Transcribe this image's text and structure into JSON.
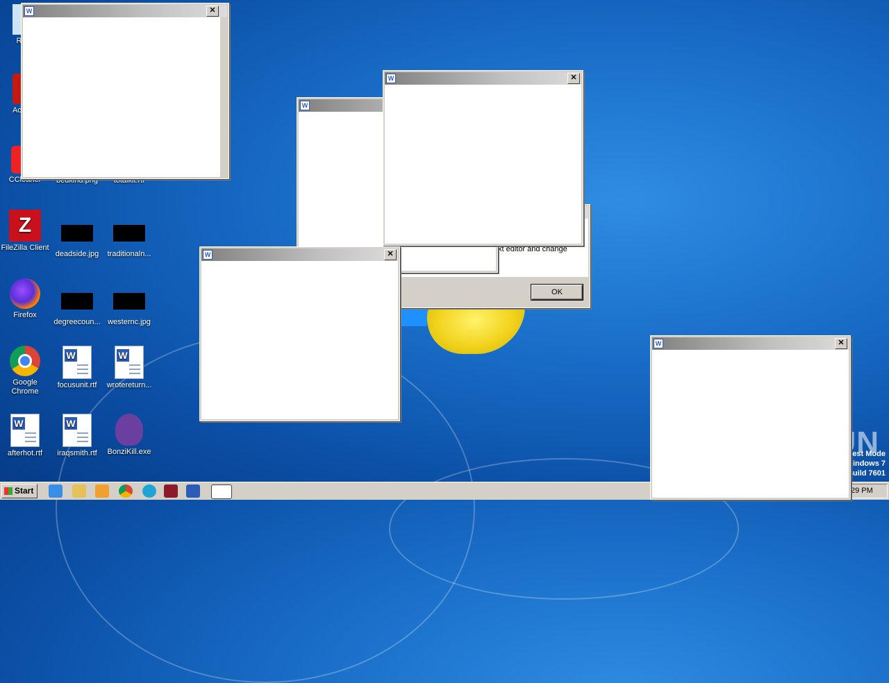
{
  "desktop": {
    "icons": [
      {
        "label": "Recy",
        "icon": "recycle-bin-icon"
      },
      {
        "label": "Ac Rea",
        "icon": "acrobat-reader-icon"
      },
      {
        "label": "CCleaner",
        "icon": "ccleaner-icon"
      },
      {
        "label": "bedkind.png",
        "icon": "image-file-icon"
      },
      {
        "label": "totalkit.rtf",
        "icon": "rtf-document-icon"
      },
      {
        "label": "FileZilla Client",
        "icon": "filezilla-icon"
      },
      {
        "label": "deadside.jpg",
        "icon": "image-file-icon"
      },
      {
        "label": "traditionaln...",
        "icon": "image-file-icon"
      },
      {
        "label": "Firefox",
        "icon": "firefox-icon"
      },
      {
        "label": "degreecoun...",
        "icon": "image-file-icon"
      },
      {
        "label": "westernc.jpg",
        "icon": "image-file-icon"
      },
      {
        "label": "Google Chrome",
        "icon": "chrome-icon"
      },
      {
        "label": "focusunit.rtf",
        "icon": "rtf-document-icon"
      },
      {
        "label": "wrotereturn...",
        "icon": "rtf-document-icon"
      },
      {
        "label": "afterhot.rtf",
        "icon": "rtf-document-icon"
      },
      {
        "label": "iraqsmith.rtf",
        "icon": "rtf-document-icon"
      },
      {
        "label": "BonziKill.exe",
        "icon": "bonzi-icon"
      }
    ]
  },
  "dialog": {
    "message_fragment": "xt editor and change",
    "ok_label": "OK"
  },
  "windows": {
    "close_glyph": "✕",
    "app_icon_glyph": "W"
  },
  "taskbar": {
    "start_label": "Start",
    "clock": "29 PM"
  },
  "overlay": {
    "watermark": "ANY▷RUN",
    "test_mode_line1": "est Mode",
    "test_mode_line2": "indows 7",
    "test_mode_line3": "Build 7601"
  }
}
